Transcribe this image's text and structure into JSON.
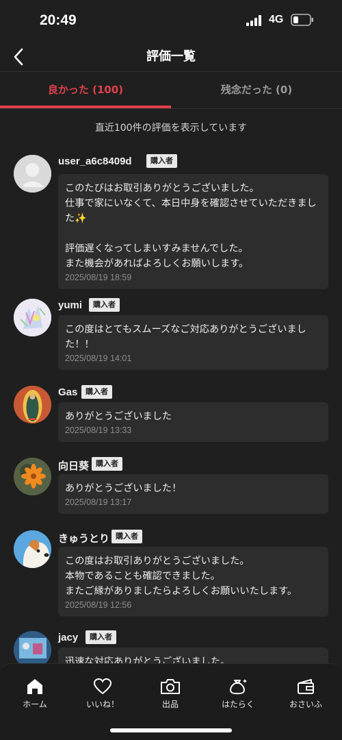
{
  "status": {
    "time": "20:49",
    "network": "4G"
  },
  "nav": {
    "title": "評価一覧"
  },
  "tabs": [
    {
      "label": "良かった (100)"
    },
    {
      "label": "残念だった (0)"
    }
  ],
  "notice": "直近100件の評価を表示しています",
  "badge_label": "購入者",
  "reviews": [
    {
      "name": "user_a6c8409d",
      "text": "このたびはお取引ありがとうございました。\n仕事で家にいなくて、本日中身を確認させていただきました✨\n\n評価遅くなってしまいすみませんでした。\nまた機会があればよろしくお願いします。",
      "date": "2025/08/19 18:59"
    },
    {
      "name": "yumi",
      "text": "この度はとてもスムーズなご対応ありがとうございました！！",
      "date": "2025/08/19 14:01"
    },
    {
      "name": "Gas",
      "text": "ありがとうございました",
      "date": "2025/08/19 13:33"
    },
    {
      "name": "向日葵",
      "text": "ありがとうございました！",
      "date": "2025/08/19 13:17"
    },
    {
      "name": "きゅうとり",
      "text": "この度はお取引ありがとうございました。\n本物であることも確認できました。\nまたご縁がありましたらよろしくお願いいたします。",
      "date": "2025/08/19 12:56"
    },
    {
      "name": "jacy",
      "text": "迅速な対応ありがとうございました。",
      "date": ""
    }
  ],
  "bottom_nav": [
    {
      "label": "ホーム",
      "icon": "home-icon"
    },
    {
      "label": "いいね！",
      "icon": "heart-icon"
    },
    {
      "label": "出品",
      "icon": "camera-icon"
    },
    {
      "label": "はたらく",
      "icon": "money-bag-icon"
    },
    {
      "label": "おさいふ",
      "icon": "wallet-icon"
    }
  ]
}
